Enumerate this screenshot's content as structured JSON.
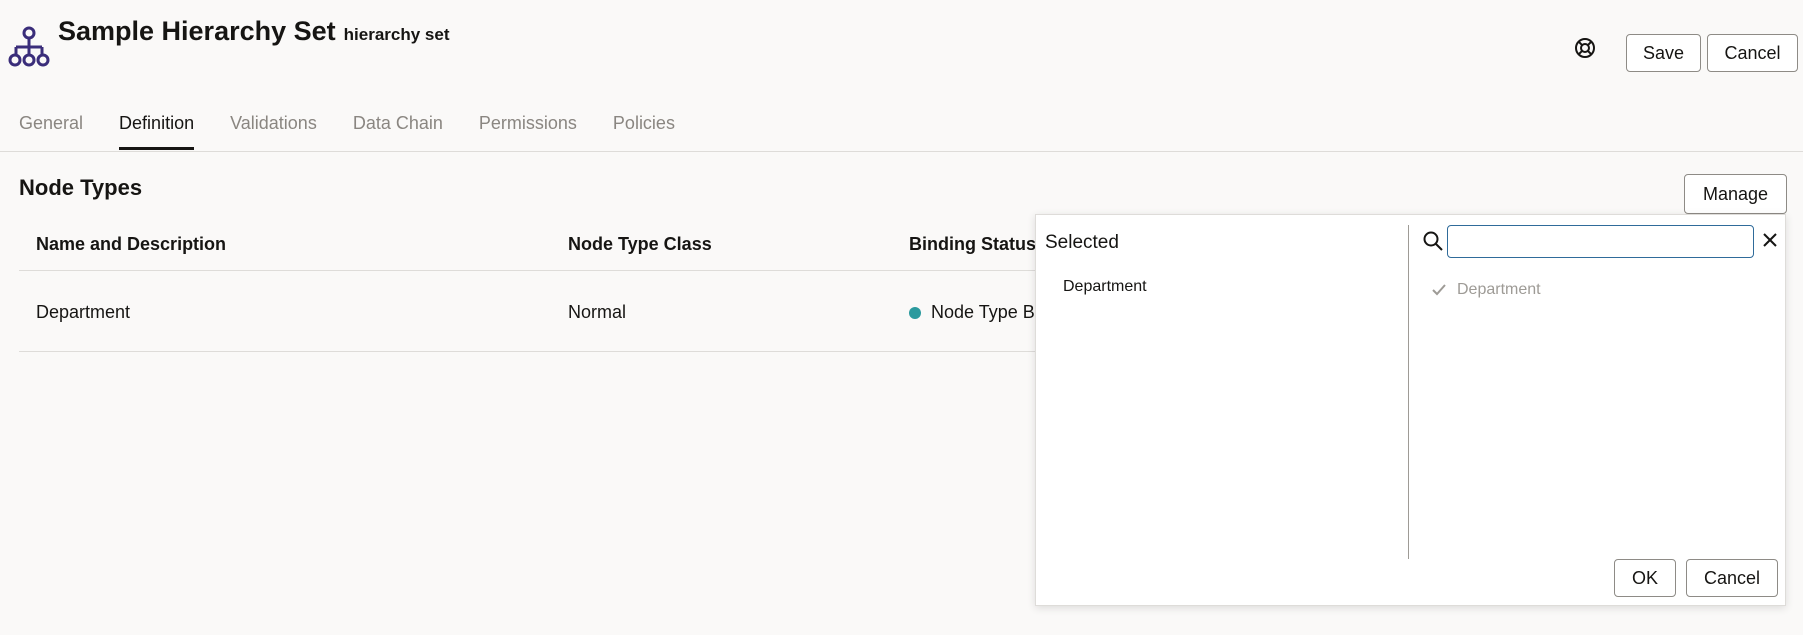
{
  "header": {
    "title": "Sample Hierarchy Set",
    "subtitle": "hierarchy set",
    "save_label": "Save",
    "cancel_label": "Cancel"
  },
  "tabs": [
    {
      "label": "General",
      "active": false
    },
    {
      "label": "Definition",
      "active": true
    },
    {
      "label": "Validations",
      "active": false
    },
    {
      "label": "Data Chain",
      "active": false
    },
    {
      "label": "Permissions",
      "active": false
    },
    {
      "label": "Policies",
      "active": false
    }
  ],
  "section": {
    "title": "Node Types",
    "manage_label": "Manage"
  },
  "table": {
    "columns": [
      "Name and Description",
      "Node Type Class",
      "Binding Status"
    ],
    "rows": [
      {
        "name": "Department",
        "class": "Normal",
        "binding": "Node Type Bo"
      }
    ]
  },
  "popup": {
    "selected_title": "Selected",
    "selected_items": [
      "Department"
    ],
    "search_value": "",
    "results": [
      "Department"
    ],
    "ok_label": "OK",
    "cancel_label": "Cancel"
  },
  "colors": {
    "icon": "#3a2d7a",
    "status": "#2b9a9e",
    "accent": "#2f6b9a"
  }
}
